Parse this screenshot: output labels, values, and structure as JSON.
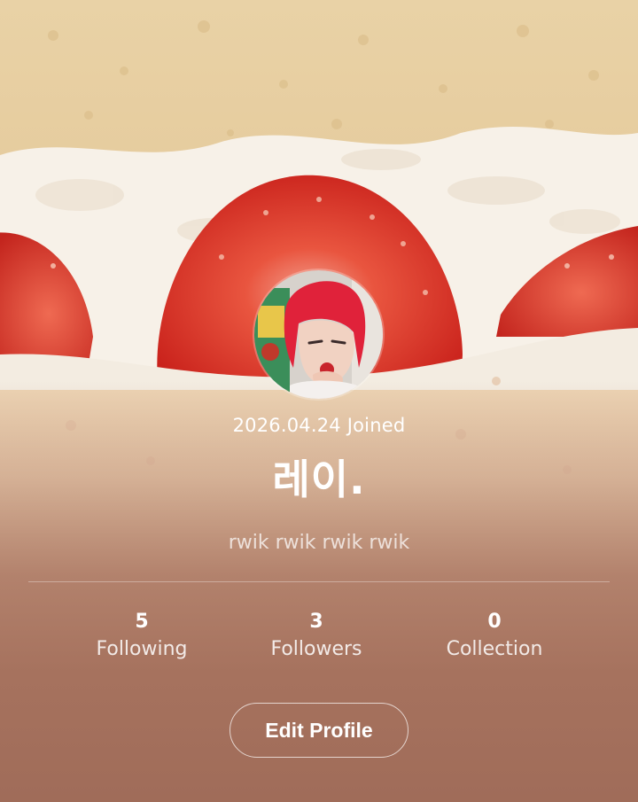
{
  "profile": {
    "joined_text": "2026.04.24 Joined",
    "nickname": "레이.",
    "bio": "rwik rwik rwik rwik",
    "avatar": "profile-photo"
  },
  "stats": {
    "following": {
      "count": "5",
      "label": "Following"
    },
    "followers": {
      "count": "3",
      "label": "Followers"
    },
    "collection": {
      "count": "0",
      "label": "Collection"
    }
  },
  "actions": {
    "edit_profile_label": "Edit Profile"
  },
  "background": {
    "image": "strawberry-cream-cake"
  }
}
